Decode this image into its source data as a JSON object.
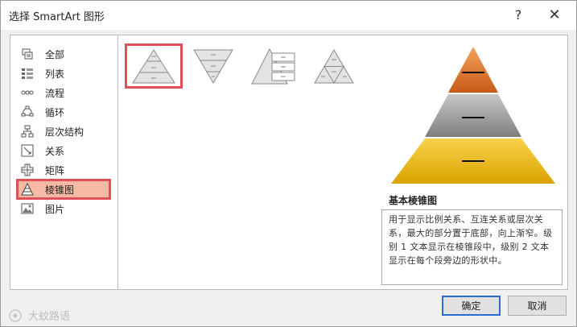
{
  "window": {
    "title": "选择 SmartArt 图形",
    "help_label": "?",
    "close_label": "✕"
  },
  "categories": [
    {
      "label": "全部",
      "icon": "all-icon"
    },
    {
      "label": "列表",
      "icon": "list-icon"
    },
    {
      "label": "流程",
      "icon": "process-icon"
    },
    {
      "label": "循环",
      "icon": "cycle-icon"
    },
    {
      "label": "层次结构",
      "icon": "hierarchy-icon"
    },
    {
      "label": "关系",
      "icon": "relationship-icon"
    },
    {
      "label": "矩阵",
      "icon": "matrix-icon"
    },
    {
      "label": "棱锥图",
      "icon": "pyramid-icon",
      "selected": true
    },
    {
      "label": "图片",
      "icon": "picture-icon"
    }
  ],
  "layouts": [
    {
      "name": "basic-pyramid",
      "selected": true
    },
    {
      "name": "inverted-pyramid"
    },
    {
      "name": "pyramid-list"
    },
    {
      "name": "segmented-pyramid"
    }
  ],
  "preview": {
    "title": "基本棱锥图",
    "description": "用于显示比例关系、互连关系或层次关系，最大的部分置于底部，向上渐窄。级别 1 文本显示在棱锥段中，级别 2 文本显示在每个段旁边的形状中。"
  },
  "buttons": {
    "ok": "确定",
    "cancel": "取消"
  },
  "watermark": "大蚊路语",
  "colors": {
    "selection_border": "#e0505a",
    "selection_fill": "#f6b9a3",
    "primary_button_border": "#2d6bd3",
    "pyramid_top": "#e8863c",
    "pyramid_middle": "#9a9a9a",
    "pyramid_bottom": "#f2c21a"
  }
}
